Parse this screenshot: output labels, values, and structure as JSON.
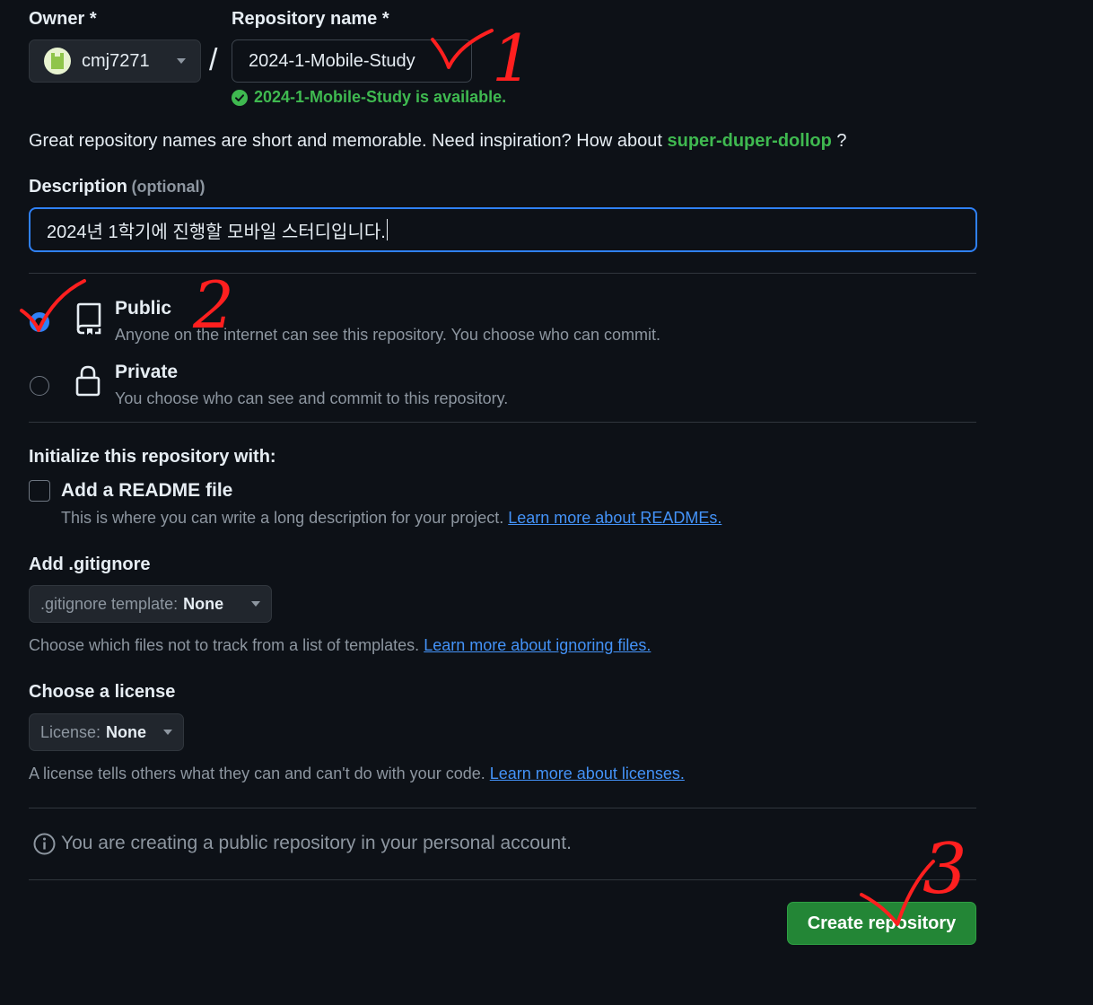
{
  "owner": {
    "label": "Owner",
    "required_mark": "*",
    "value": "cmj7271"
  },
  "separator": "/",
  "repo_name": {
    "label": "Repository name",
    "required_mark": "*",
    "value": "2024-1-Mobile-Study",
    "availability": "2024-1-Mobile-Study is available."
  },
  "inspiration": {
    "text": "Great repository names are short and memorable. Need inspiration? How about",
    "suggestion": "super-duper-dollop",
    "suffix": "?"
  },
  "description": {
    "label": "Description",
    "optional": "(optional)",
    "value": "2024년 1학기에 진행할 모바일 스터디입니다."
  },
  "visibility": {
    "public": {
      "title": "Public",
      "desc": "Anyone on the internet can see this repository. You choose who can commit.",
      "checked": true
    },
    "private": {
      "title": "Private",
      "desc": "You choose who can see and commit to this repository.",
      "checked": false
    }
  },
  "init": {
    "heading": "Initialize this repository with:",
    "readme_label": "Add a README file",
    "readme_desc": "This is where you can write a long description for your project.",
    "readme_link": "Learn more about READMEs."
  },
  "gitignore": {
    "heading": "Add .gitignore",
    "button_prefix": ".gitignore template:",
    "button_value": "None",
    "desc": "Choose which files not to track from a list of templates.",
    "link": "Learn more about ignoring files."
  },
  "license": {
    "heading": "Choose a license",
    "button_prefix": "License:",
    "button_value": "None",
    "desc": "A license tells others what they can and can't do with your code.",
    "link": "Learn more about licenses."
  },
  "notice": "You are creating a public repository in your personal account.",
  "create_button": "Create repository",
  "annotations": {
    "one": "1",
    "two": "2",
    "three": "3"
  },
  "colors": {
    "accent": "#2f81f7",
    "success": "#3fb950",
    "button_green": "#238636",
    "annotation": "#ff1f1f"
  }
}
